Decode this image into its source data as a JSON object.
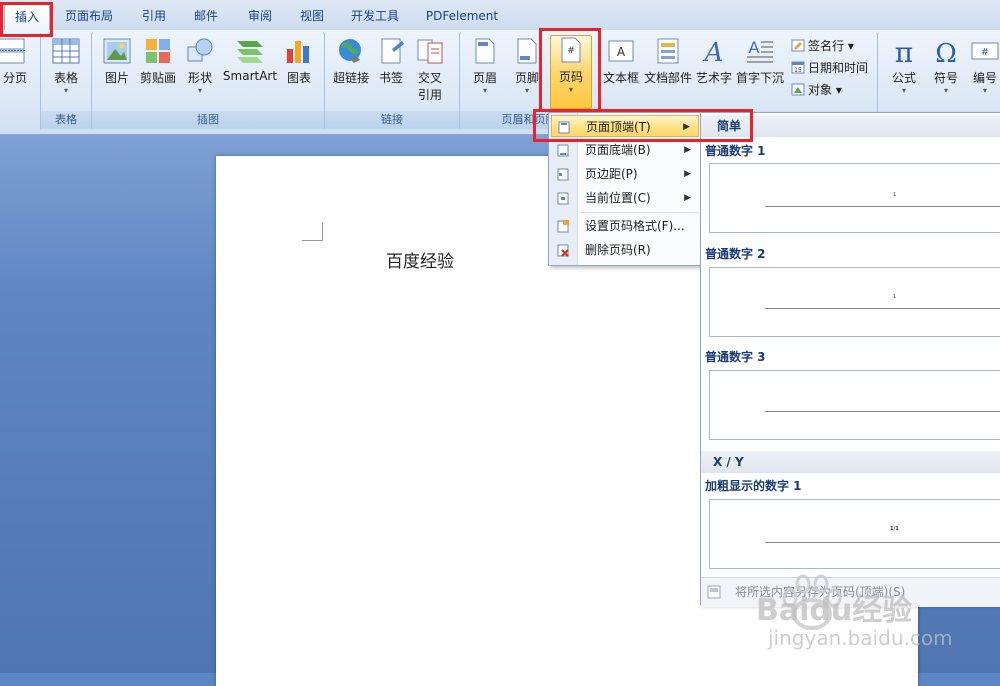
{
  "tabs": [
    "插入",
    "页面布局",
    "引用",
    "邮件",
    "审阅",
    "视图",
    "开发工具",
    "PDFelement"
  ],
  "ribbon": {
    "buttons": {
      "page_break": "分页",
      "table": "表格",
      "picture": "图片",
      "clipart": "剪贴画",
      "shapes": "形状",
      "smartart": "SmartArt",
      "chart": "图表",
      "hyperlink": "超链接",
      "bookmark": "书签",
      "crossref_1": "交叉",
      "crossref_2": "引用",
      "header": "页眉",
      "footer": "页脚",
      "page_number": "页码",
      "textbox": "文本框",
      "quickparts": "文档部件",
      "wordart": "艺术字",
      "dropcap": "首字下沉",
      "signature": "签名行 ▾",
      "datetime": "日期和时间",
      "object": "对象 ▾",
      "equation": "公式",
      "symbol": "符号",
      "numbering": "编号"
    },
    "groups": {
      "tables": "表格",
      "illustrations": "插图",
      "links": "链接",
      "header_footer": "页眉和页脚"
    }
  },
  "document": {
    "text": "百度经验"
  },
  "menu": {
    "items": [
      {
        "label": "页面顶端(T)",
        "submenu": true
      },
      {
        "label": "页面底端(B)",
        "submenu": true
      },
      {
        "label": "页边距(P)",
        "submenu": true
      },
      {
        "label": "当前位置(C)",
        "submenu": true
      },
      {
        "label": "设置页码格式(F)...",
        "submenu": false
      },
      {
        "label": "删除页码(R)",
        "submenu": false
      }
    ],
    "arrow": "▶"
  },
  "gallery": {
    "header_simple": "简单",
    "items": [
      {
        "label": "普通数字 1",
        "sample": "1"
      },
      {
        "label": "普通数字 2",
        "sample": "1"
      },
      {
        "label": "普通数字 3",
        "sample": ""
      }
    ],
    "header_xy": "X / Y",
    "bold_item": {
      "label": "加粗显示的数字 1",
      "sample": "1/1"
    },
    "footer": "将所选内容另存为页码(顶端)(S)"
  },
  "watermark": {
    "brand": "Baidu经验",
    "url": "jingyan.baidu.com"
  },
  "colors": {
    "highlight_box": "#e8232c",
    "ribbon_text": "#15428b"
  }
}
